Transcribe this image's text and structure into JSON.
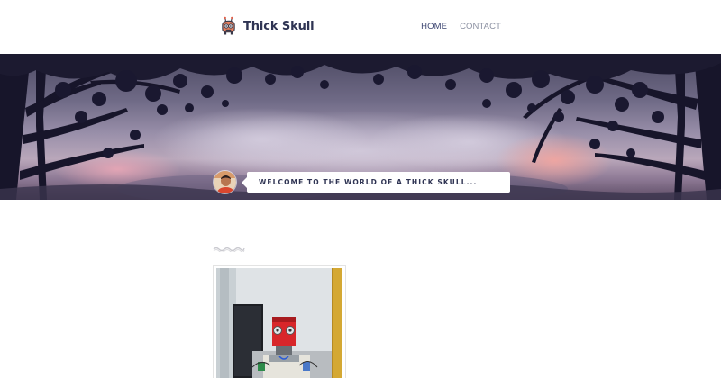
{
  "site": {
    "title": "Thick Skull",
    "logo_icon": "skull-robot-icon"
  },
  "nav": {
    "items": [
      {
        "label": "HOME",
        "active": true
      },
      {
        "label": "CONTACT",
        "active": false
      }
    ]
  },
  "hero": {
    "tagline": "WELCOME TO THE WORLD OF A THICK SKULL...",
    "avatar_icon": "author-avatar"
  },
  "colors": {
    "brand_text": "#2f3453",
    "nav_active": "#3b4470",
    "nav_inactive": "#8c91a2",
    "sky_top": "#4d4a63",
    "sky_glow": "#d9a0b0"
  },
  "content": {
    "divider_icon": "wave-divider-icon",
    "thumbnail": "robot-photo"
  }
}
